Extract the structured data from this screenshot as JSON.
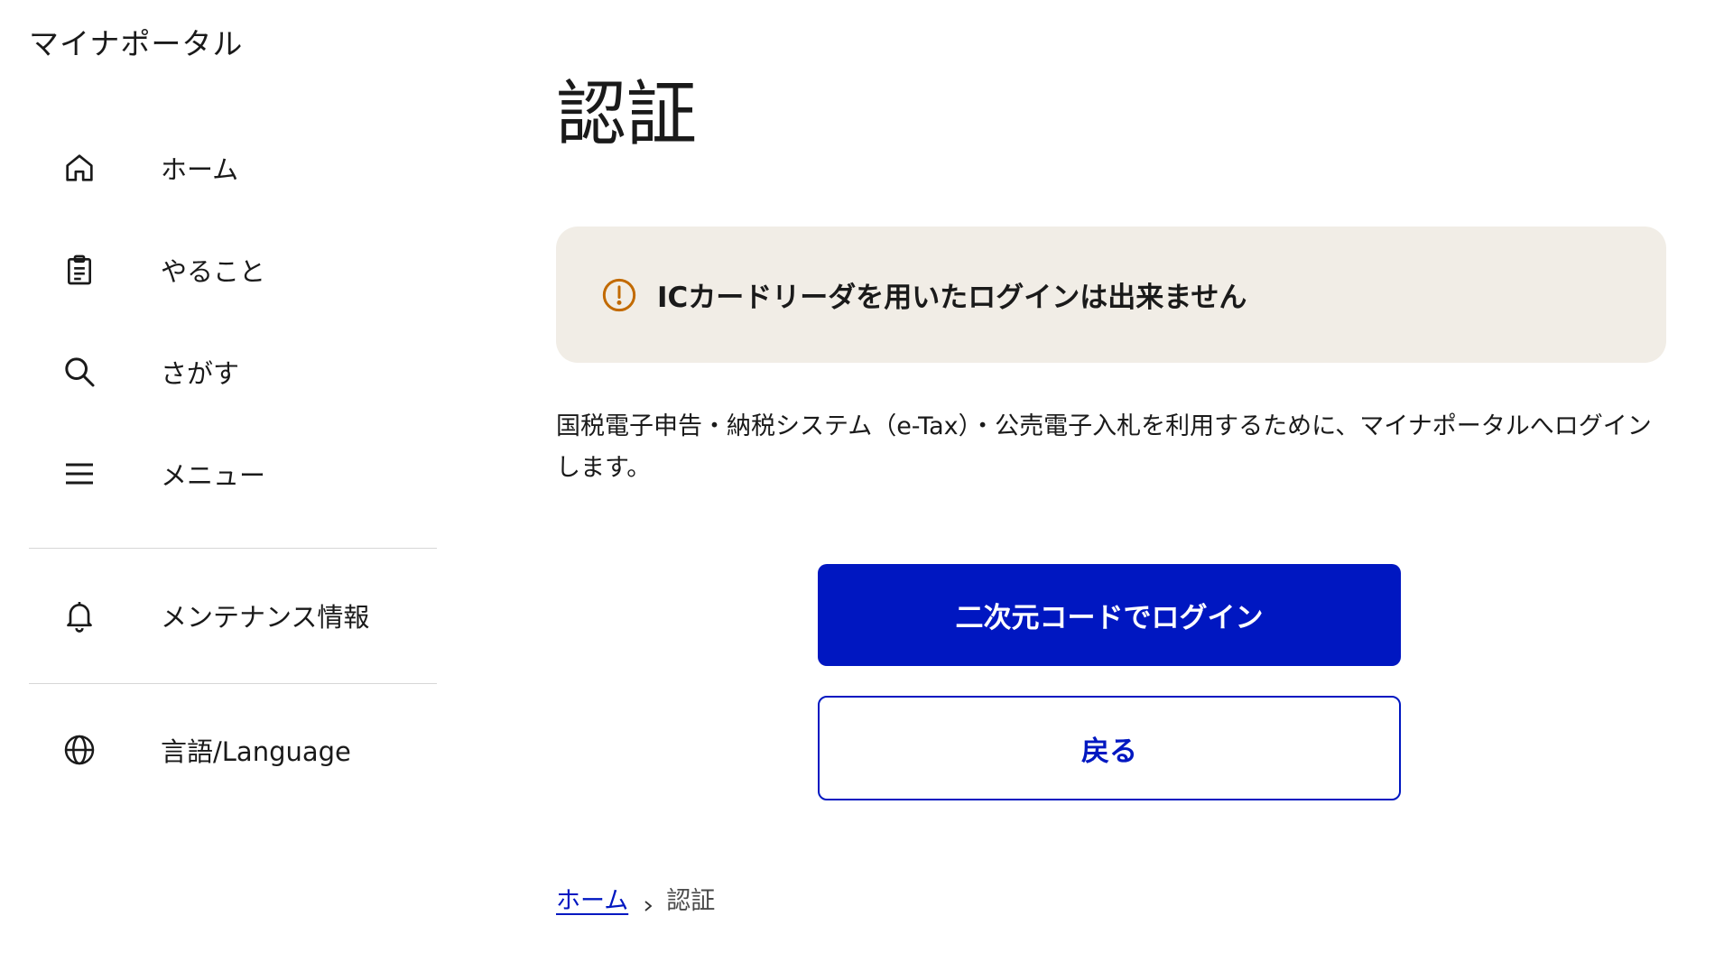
{
  "app": {
    "title": "マイナポータル"
  },
  "sidebar": {
    "items": [
      {
        "label": "ホーム",
        "icon": "home-icon"
      },
      {
        "label": "やること",
        "icon": "clipboard-icon"
      },
      {
        "label": "さがす",
        "icon": "search-icon"
      },
      {
        "label": "メニュー",
        "icon": "menu-icon"
      },
      {
        "label": "メンテナンス情報",
        "icon": "bell-icon"
      },
      {
        "label": "言語/Language",
        "icon": "globe-icon"
      }
    ]
  },
  "main": {
    "title": "認証",
    "notice": {
      "icon": "warning-circle-icon",
      "text": "ICカードリーダを用いたログインは出来ません"
    },
    "description": "国税電子申告・納税システム（e-Tax）・公売電子入札を利用するために、マイナポータルへログインします。",
    "buttons": {
      "primary": "二次元コードでログイン",
      "secondary": "戻る"
    },
    "breadcrumb": {
      "home": "ホーム",
      "current": "認証"
    }
  },
  "colors": {
    "accent": "#0017c1",
    "notice_bg": "#f1ede6",
    "warning": "#c26a00"
  }
}
